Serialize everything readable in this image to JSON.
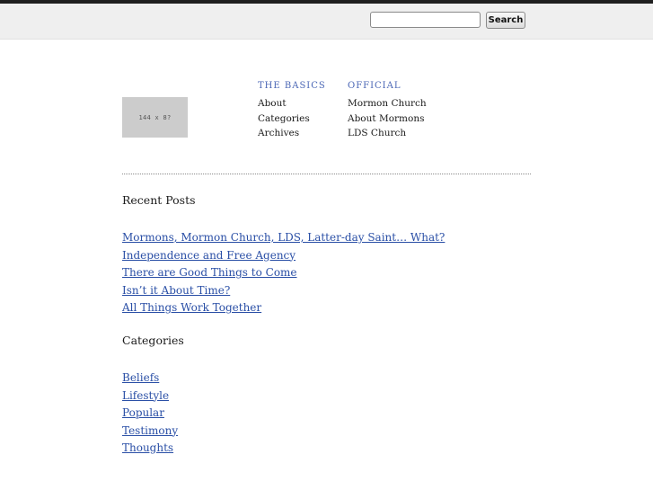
{
  "header": {
    "search": {
      "value": "",
      "placeholder": ""
    },
    "search_button_label": "Search"
  },
  "logo": {
    "text": "144 x 8?"
  },
  "nav": {
    "basics": {
      "heading": "THE BASICS",
      "links": [
        "About",
        "Categories",
        "Archives"
      ]
    },
    "official": {
      "heading": "OFFICIAL",
      "links": [
        "Mormon Church",
        "About Mormons",
        "LDS Church"
      ]
    }
  },
  "recent_posts": {
    "title": "Recent Posts",
    "items": [
      "Mormons, Mormon Church, LDS, Latter-day Saint… What?",
      "Independence and Free Agency",
      "There are Good Things to Come",
      "Isn’t it About Time?",
      "All Things Work Together"
    ]
  },
  "categories": {
    "title": "Categories",
    "items": [
      "Beliefs",
      "Lifestyle",
      "Popular",
      "Testimony",
      "Thoughts"
    ]
  },
  "colors": {
    "link": "#2a4fa6",
    "nav_heading": "#4a66b5",
    "top_bar": "#efefef",
    "top_rule": "#1f1f1f"
  }
}
